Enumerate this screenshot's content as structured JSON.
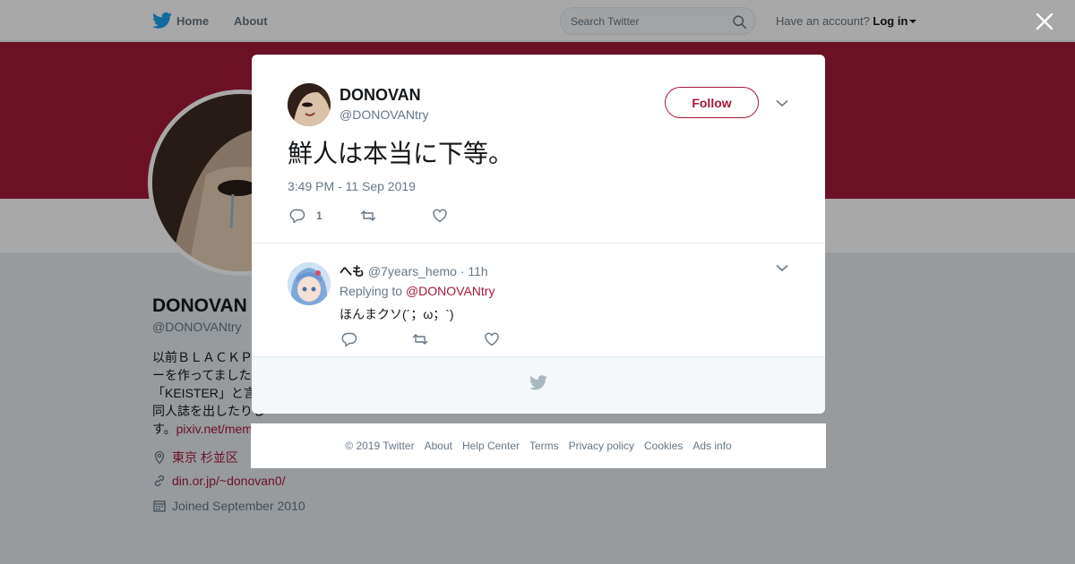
{
  "topbar": {
    "home": "Home",
    "about": "About",
    "search_placeholder": "Search Twitter",
    "have_account": "Have an account?",
    "login": "Log in"
  },
  "background_profile": {
    "name": "DONOVAN",
    "handle": "@DONOVANtry",
    "bio_lines": [
      "以前ＢＬＡＣＫＰ",
      "ーを作ってました",
      "「KEISTER」と言",
      "同人誌を出したりし",
      "す。"
    ],
    "bio_link": "pixiv.net/mem",
    "location": "東京 杉並区",
    "website": "din.or.jp/~donovan0/",
    "joined": "Joined September 2010"
  },
  "tweet": {
    "name": "DONOVAN",
    "handle": "@DONOVANtry",
    "follow_label": "Follow",
    "text": "鮮人は本当に下等。",
    "timestamp": "3:49 PM - 11 Sep 2019",
    "reply_count": "1"
  },
  "reply": {
    "name": "へも",
    "handle": "@7years_hemo",
    "dot": "·",
    "age": "11h",
    "replying_prefix": "Replying to",
    "replying_to": "@DONOVANtry",
    "text": "ほんまクソ(´；ω；`)"
  },
  "footer": {
    "links": [
      "© 2019 Twitter",
      "About",
      "Help Center",
      "Terms",
      "Privacy policy",
      "Cookies",
      "Ads info"
    ]
  },
  "colors": {
    "accent": "#a5193a",
    "twitter_blue": "#1da1f2",
    "secondary_text": "#657786"
  },
  "icons": [
    "twitter-bird-icon",
    "search-icon",
    "caret-down-icon",
    "close-icon",
    "chevron-down-icon",
    "reply-icon",
    "retweet-icon",
    "like-icon",
    "location-icon",
    "link-icon",
    "calendar-icon"
  ]
}
